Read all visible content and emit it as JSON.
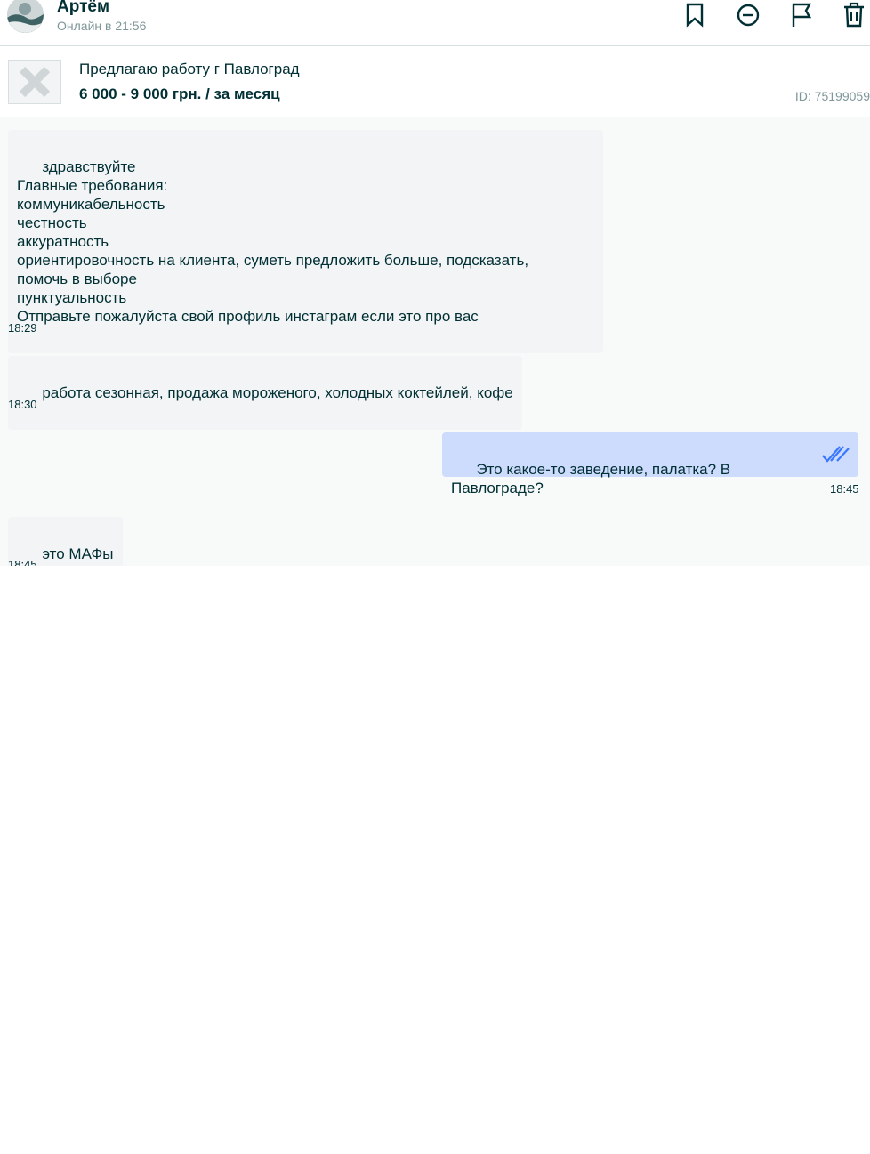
{
  "header": {
    "user_name": "Артём",
    "user_status": "Онлайн в 21:56",
    "actions": [
      {
        "name": "bookmark-icon"
      },
      {
        "name": "block-icon"
      },
      {
        "name": "flag-icon"
      },
      {
        "name": "trash-icon"
      }
    ]
  },
  "ad": {
    "title": "Предлагаю работу г Павлоград",
    "price": "6 000 - 9 000 грн. / за месяц",
    "id": "ID: 75199059",
    "thumbnail_icon": "image-placeholder-icon"
  },
  "messages": [
    {
      "direction": "in",
      "text": "здравствуйте\nГлавные требования:\nкоммуникабельность\nчестность\nаккуратность\nориентировочность на клиента, суметь предложить больше, подсказать,\nпомочь в выборе\nпунктуальность\nОтправьте пожалуйста свой профиль инстаграм если это про вас",
      "time": "18:29"
    },
    {
      "direction": "in",
      "text": "работа сезонная, продажа мороженого, холодных коктейлей, кофе",
      "time": "18:30"
    },
    {
      "direction": "out",
      "text": "Это какое-то заведение, палатка? В Павлограде?",
      "time": "18:45",
      "status_icon": "double-check-icon"
    },
    {
      "direction": "in",
      "text": "это МАФы",
      "time": "18:45"
    }
  ],
  "colors": {
    "text": "#002f34",
    "muted": "#7f9799",
    "incoming_bubble": "#f2f4f5",
    "outgoing_bubble": "#cddbfd",
    "read_check": "#3a77ff",
    "chat_background": "#f8f9f9"
  }
}
